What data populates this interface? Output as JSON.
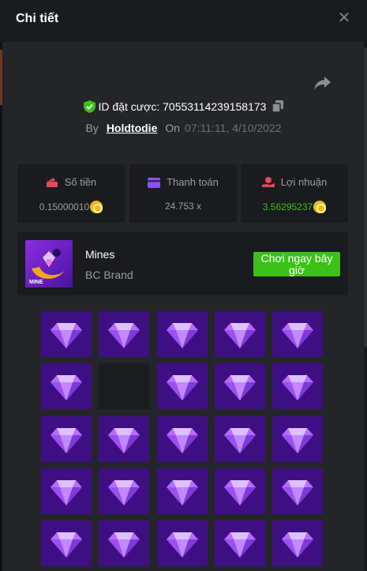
{
  "header": {
    "title": "Chi tiết",
    "close_icon": "close-icon"
  },
  "bet": {
    "id_label": "ID đặt cược: 70553114239158173",
    "by_label": "By",
    "user": "Holdtodie",
    "on_label": "On",
    "timestamp": "07:11:11, 4/10/2022"
  },
  "stats": [
    {
      "label": "Số tiền",
      "value": "0.15000010",
      "icon": "money-icon",
      "icon_color": "#e8465a"
    },
    {
      "label": "Thanh toán",
      "value": "24.753 x",
      "icon": "card-icon",
      "icon_color": "#8c52f0"
    },
    {
      "label": "Lợi nhuận",
      "value": "3.56295237",
      "icon": "profit-icon",
      "icon_color": "#e8465a",
      "value_color": "#3bc117"
    }
  ],
  "game": {
    "name": "Mines",
    "brand": "BC Brand",
    "thumb_label": "MINE",
    "play_label": "Chơi ngay bây giờ",
    "accent": "#3bc117"
  },
  "board": {
    "cols": 5,
    "rows": 5,
    "cells": [
      "gem",
      "gem",
      "gem",
      "gem",
      "gem",
      "gem",
      "empty",
      "gem",
      "gem",
      "gem",
      "gem",
      "gem",
      "gem",
      "gem",
      "gem",
      "gem",
      "gem",
      "gem",
      "gem",
      "gem",
      "gem",
      "gem",
      "gem",
      "gem",
      "gem"
    ],
    "gem_color": "#b56cff",
    "tile_color": "#3e0f83"
  }
}
